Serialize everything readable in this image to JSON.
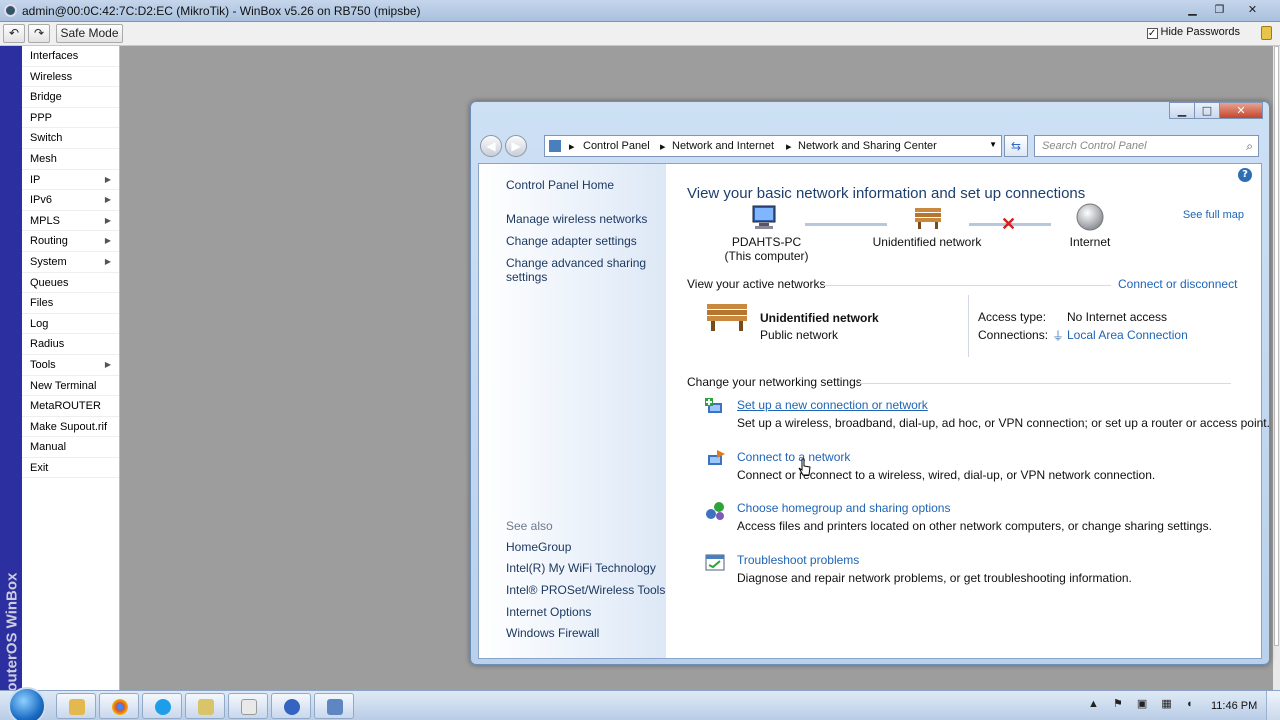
{
  "winbox": {
    "title": "admin@00:0C:42:7C:D2:EC (MikroTik) - WinBox v5.26 on RB750 (mipsbe)",
    "safe_mode": "Safe Mode",
    "hide_passwords": "Hide Passwords",
    "brand": "RouterOS WinBox",
    "menu": [
      {
        "label": "Interfaces",
        "submenu": false
      },
      {
        "label": "Wireless",
        "submenu": false
      },
      {
        "label": "Bridge",
        "submenu": false
      },
      {
        "label": "PPP",
        "submenu": false
      },
      {
        "label": "Switch",
        "submenu": false
      },
      {
        "label": "Mesh",
        "submenu": false
      },
      {
        "label": "IP",
        "submenu": true
      },
      {
        "label": "IPv6",
        "submenu": true
      },
      {
        "label": "MPLS",
        "submenu": true
      },
      {
        "label": "Routing",
        "submenu": true
      },
      {
        "label": "System",
        "submenu": true
      },
      {
        "label": "Queues",
        "submenu": false
      },
      {
        "label": "Files",
        "submenu": false
      },
      {
        "label": "Log",
        "submenu": false
      },
      {
        "label": "Radius",
        "submenu": false
      },
      {
        "label": "Tools",
        "submenu": true
      },
      {
        "label": "New Terminal",
        "submenu": false
      },
      {
        "label": "MetaROUTER",
        "submenu": false
      },
      {
        "label": "Make Supout.rif",
        "submenu": false
      },
      {
        "label": "Manual",
        "submenu": false
      },
      {
        "label": "Exit",
        "submenu": false
      }
    ]
  },
  "control_panel": {
    "breadcrumb": [
      "Control Panel",
      "Network and Internet",
      "Network and Sharing Center"
    ],
    "search_placeholder": "Search Control Panel",
    "left": {
      "home": "Control Panel Home",
      "links": [
        "Manage wireless networks",
        "Change adapter settings",
        "Change advanced sharing settings"
      ],
      "see_also_label": "See also",
      "see_also": [
        "HomeGroup",
        "Intel(R) My WiFi Technology",
        "Intel® PROSet/Wireless Tools",
        "Internet Options",
        "Windows Firewall"
      ]
    },
    "heading": "View your basic network information and set up connections",
    "see_full_map": "See full map",
    "map": {
      "computer": "PDAHTS-PC",
      "computer_sub": "(This computer)",
      "network": "Unidentified network",
      "internet": "Internet"
    },
    "active_networks_label": "View your active networks",
    "connect_disconnect": "Connect or disconnect",
    "active": {
      "name": "Unidentified network",
      "type": "Public network",
      "access_type_label": "Access type:",
      "access_type_value": "No Internet access",
      "connections_label": "Connections:",
      "connections_value": "Local Area Connection"
    },
    "change_settings_label": "Change your networking settings",
    "tasks": [
      {
        "title": "Set up a new connection or network",
        "desc": "Set up a wireless, broadband, dial-up, ad hoc, or VPN connection; or set up a router or access point."
      },
      {
        "title": "Connect to a network",
        "desc": "Connect or reconnect to a wireless, wired, dial-up, or VPN network connection."
      },
      {
        "title": "Choose homegroup and sharing options",
        "desc": "Access files and printers located on other network computers, or change sharing settings."
      },
      {
        "title": "Troubleshoot problems",
        "desc": "Diagnose and repair network problems, or get troubleshooting information."
      }
    ]
  },
  "taskbar": {
    "clock": "11:46 PM"
  }
}
